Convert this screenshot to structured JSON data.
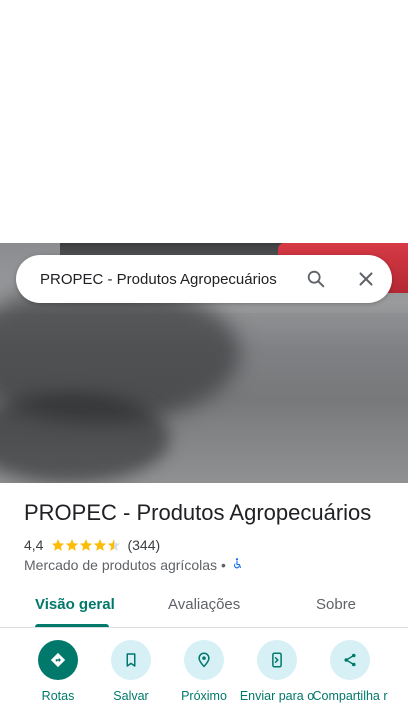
{
  "search": {
    "query": "PROPEC - Produtos Agropecuários"
  },
  "place": {
    "title": "PROPEC - Produtos Agropecuários",
    "rating": "4,4",
    "rating_value": 4.4,
    "reviews": "(344)",
    "category": "Mercado de produtos agrícolas",
    "separator": "•"
  },
  "tabs": [
    {
      "label": "Visão geral",
      "active": true
    },
    {
      "label": "Avaliações",
      "active": false
    },
    {
      "label": "Sobre",
      "active": false
    }
  ],
  "actions": [
    {
      "label": "Rotas",
      "icon": "directions-icon"
    },
    {
      "label": "Salvar",
      "icon": "bookmark-icon"
    },
    {
      "label": "Próximo",
      "icon": "nearby-icon"
    },
    {
      "label": "Enviar para o",
      "icon": "send-to-phone-icon"
    },
    {
      "label": "Compartilha r",
      "icon": "share-icon"
    }
  ],
  "colors": {
    "accent": "#00796b",
    "star": "#fbbc04",
    "chip_bg": "#d6f0f5"
  }
}
